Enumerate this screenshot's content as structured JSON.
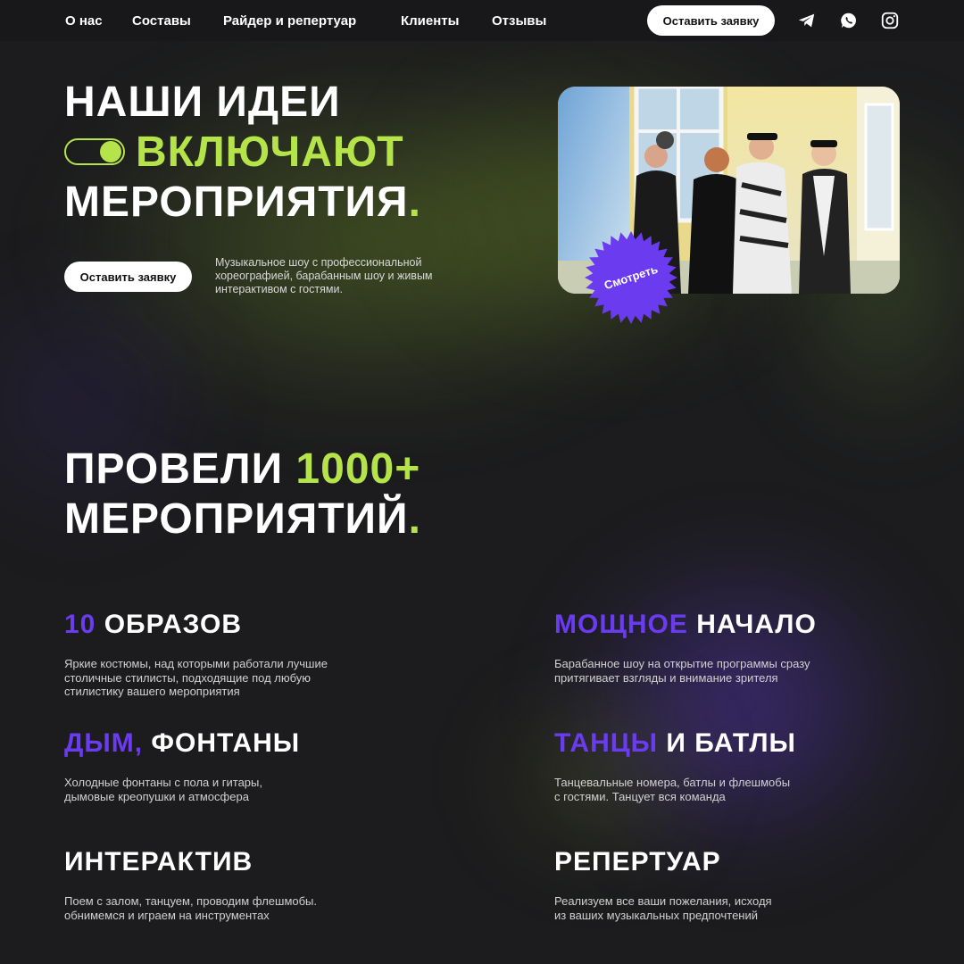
{
  "nav": {
    "links": [
      "О нас",
      "Составы",
      "Райдер и репертуар",
      "Клиенты",
      "Отзывы"
    ],
    "cta_label": "Оставить заявку",
    "icons": [
      "telegram-icon",
      "whatsapp-icon",
      "instagram-icon"
    ]
  },
  "hero": {
    "line1": "НАШИ ИДЕИ",
    "line2_accent": "ВКЛЮЧАЮТ",
    "line3": "МЕРОПРИЯТИЯ",
    "period": ".",
    "cta_label": "Оставить заявку",
    "description": "Музыкальное шоу с профессиональной хореографией, барабанным шоу и живым интерактивом с гостями.",
    "watch_label": "Смотреть"
  },
  "stats": {
    "line1_prefix": "ПРОВЕЛИ",
    "line1_accent": "1000+",
    "line2": "МЕРОПРИЯТИЙ",
    "period": "."
  },
  "features": [
    {
      "accent": "10",
      "title": "ОБРАЗОВ",
      "desc": "Яркие костюмы, над которыми работали лучшие\nстоличные стилисты, подходящие под любую\nстилистику вашего мероприятия"
    },
    {
      "accent": "МОЩНОЕ",
      "title": "НАЧАЛО",
      "desc": "Барабанное шоу на открытие программы сразу\nпритягивает взгляды и внимание зрителя"
    },
    {
      "accent": "ДЫМ,",
      "title": "ФОНТАНЫ",
      "desc": "Холодные фонтаны с пола и гитары,\nдымовые креопушки и атмосфера"
    },
    {
      "accent": "ТАНЦЫ",
      "title": "И БАТЛЫ",
      "desc": "Танцевальные номера, батлы и флешмобы\nс гостями. Танцует вся команда"
    },
    {
      "accent": "",
      "title": "ИНТЕРАКТИВ",
      "desc": "Поем с залом, танцуем, проводим флешмобы.\nобнимемся и играем на инструментах"
    },
    {
      "accent": "",
      "title": "РЕПЕРТУАР",
      "desc": "Реализуем все ваши пожелания, исходя\nиз ваших музыкальных предпочтений"
    }
  ],
  "colors": {
    "background": "#1c1c1e",
    "accent_green": "#b4e34a",
    "accent_purple": "#6b3bef",
    "text": "#ffffff"
  }
}
